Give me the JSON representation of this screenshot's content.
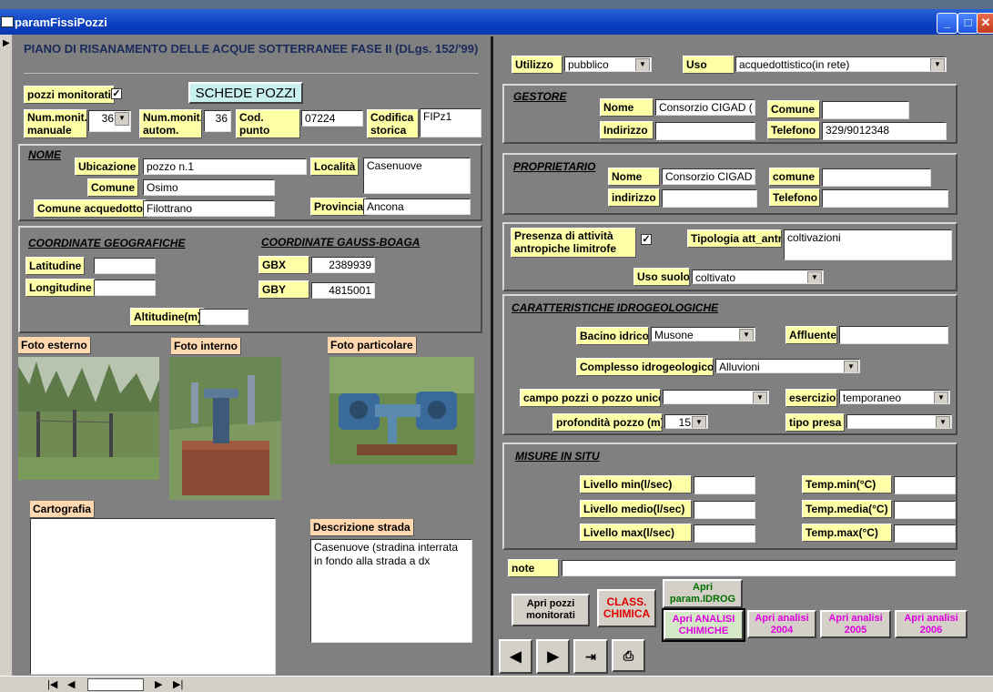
{
  "window": {
    "title": "paramFissiPozzi"
  },
  "header": {
    "title": "PIANO DI RISANAMENTO DELLE ACQUE SOTTERRANEE FASE II (DLgs. 152/'99)",
    "schede_button": "SCHEDE POZZI"
  },
  "left": {
    "pozzi_monitorati_label": "pozzi monitorati",
    "pozzi_monitorati_checked": "✓",
    "num_monit_manuale_label": "Num.monit. manuale",
    "num_monit_manuale_value": "36",
    "num_monit_autom_label": "Num.monit. autom.",
    "num_monit_autom_value": "36",
    "cod_punto_label": "Cod. punto prelievo",
    "cod_punto_value": "07224",
    "codifica_label": "Codifica storica",
    "codifica_value": "FIPz1"
  },
  "nome": {
    "title": "NOME",
    "ubicazione_label": "Ubicazione",
    "ubicazione_value": "pozzo n.1",
    "comune_label": "Comune",
    "comune_value": "Osimo",
    "comune_acq_label": "Comune acquedotto",
    "comune_acq_value": "Filottrano",
    "localita_label": "Località",
    "localita_value": "Casenuove",
    "provincia_label": "Provincia",
    "provincia_value": "Ancona"
  },
  "coord": {
    "geo_title": "COORDINATE GEOGRAFICHE",
    "gauss_title": "COORDINATE GAUSS-BOAGA",
    "lat_label": "Latitudine",
    "lat_value": "",
    "lon_label": "Longitudine",
    "lon_value": "",
    "gbx_label": "GBX",
    "gbx_value": "2389939",
    "gby_label": "GBY",
    "gby_value": "4815001",
    "alt_label": "Altitudine(m)",
    "alt_value": ""
  },
  "photos": {
    "esterno": "Foto esterno",
    "interno": "Foto interno",
    "particolare": "Foto particolare"
  },
  "cartografia_label": "Cartografia",
  "descrizione": {
    "label": "Descrizione strada",
    "value": "Casenuove (stradina interrata in fondo alla strada a dx"
  },
  "top_right": {
    "utilizzo_label": "Utilizzo",
    "utilizzo_value": "pubblico",
    "uso_label": "Uso",
    "uso_value": "acquedottistico(in rete)"
  },
  "gestore": {
    "title": "GESTORE",
    "nome_label": "Nome",
    "nome_value": "Consorzio CIGAD (",
    "comune_label": "Comune",
    "comune_value": "",
    "indirizzo_label": "Indirizzo",
    "indirizzo_value": "",
    "telefono_label": "Telefono",
    "telefono_value": "329/9012348"
  },
  "proprietario": {
    "title": "PROPRIETARIO",
    "nome_label": "Nome",
    "nome_value": "Consorzio CIGAD",
    "comune_label": "comune",
    "comune_value": "",
    "indirizzo_label": "indirizzo",
    "indirizzo_value": "",
    "telefono_label": "Telefono",
    "telefono_value": ""
  },
  "attivita": {
    "presenza_label": "Presenza di attività antropiche limitrofe",
    "presenza_checked": "✓",
    "tipologia_label": "Tipologia att_antr",
    "tipologia_value": "coltivazioni",
    "uso_suolo_label": "Uso suolo",
    "uso_suolo_value": "coltivato"
  },
  "idro": {
    "title": "CARATTERISTICHE IDROGEOLOGICHE",
    "bacino_label": "Bacino idrico",
    "bacino_value": "Musone",
    "affluente_label": "Affluente",
    "affluente_value": "",
    "complesso_label": "Complesso idrogeologico",
    "complesso_value": "Alluvioni",
    "campo_label": "campo pozzi o pozzo unico",
    "campo_value": "",
    "esercizio_label": "esercizio",
    "esercizio_value": "temporaneo",
    "prof_label": "profondità pozzo (m)",
    "prof_value": "15",
    "presa_label": "tipo presa",
    "presa_value": ""
  },
  "misure": {
    "title": "MISURE IN SITU",
    "livmin_label": "Livello min(l/sec)",
    "livmed_label": "Livello medio(l/sec)",
    "livmax_label": "Livello max(l/sec)",
    "tmin_label": "Temp.min(°C)",
    "tmed_label": "Temp.media(°C)",
    "tmax_label": "Temp.max(°C)"
  },
  "note_label": "note",
  "buttons": {
    "apri_pozzi": "Apri pozzi monitorati",
    "class_chimica": "CLASS. CHIMICA",
    "apri_param": "Apri param.IDROG",
    "apri_analisi_chimiche": "Apri ANALISI CHIMICHE",
    "apri_2004": "Apri analisi 2004",
    "apri_2005": "Apri analisi 2005",
    "apri_2006": "Apri analisi 2006"
  },
  "colors": {
    "magenta": "#e000e0",
    "red": "#e00000",
    "green": "#007000"
  }
}
